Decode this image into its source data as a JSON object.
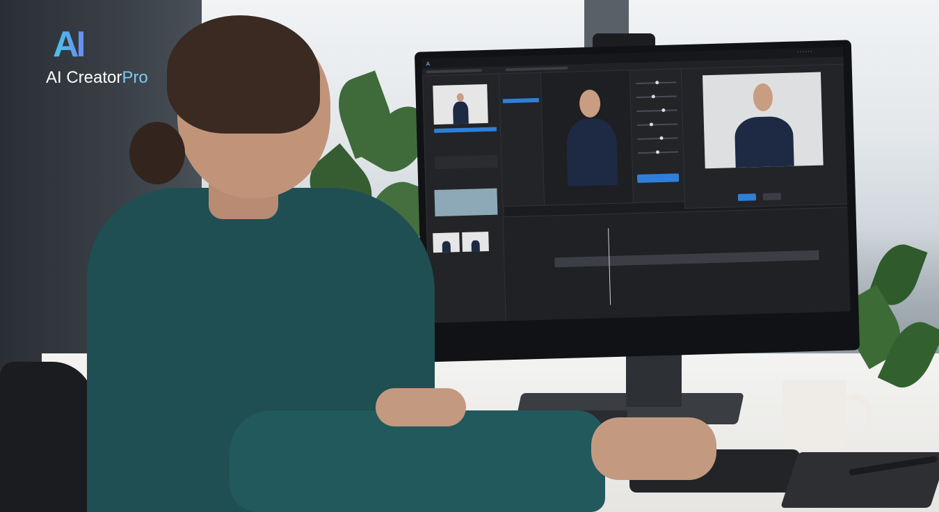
{
  "brand": {
    "mark": "AI",
    "name": "AI Creator",
    "suffix": "Pro"
  },
  "colors": {
    "accent": "#2f7fd8",
    "shirt": "#1f4f52",
    "screen_bg": "#1b1c1f"
  },
  "icons": {
    "app_logo": "app-logo-icon",
    "play": "play-icon",
    "gear": "gear-icon",
    "close": "close-icon"
  }
}
